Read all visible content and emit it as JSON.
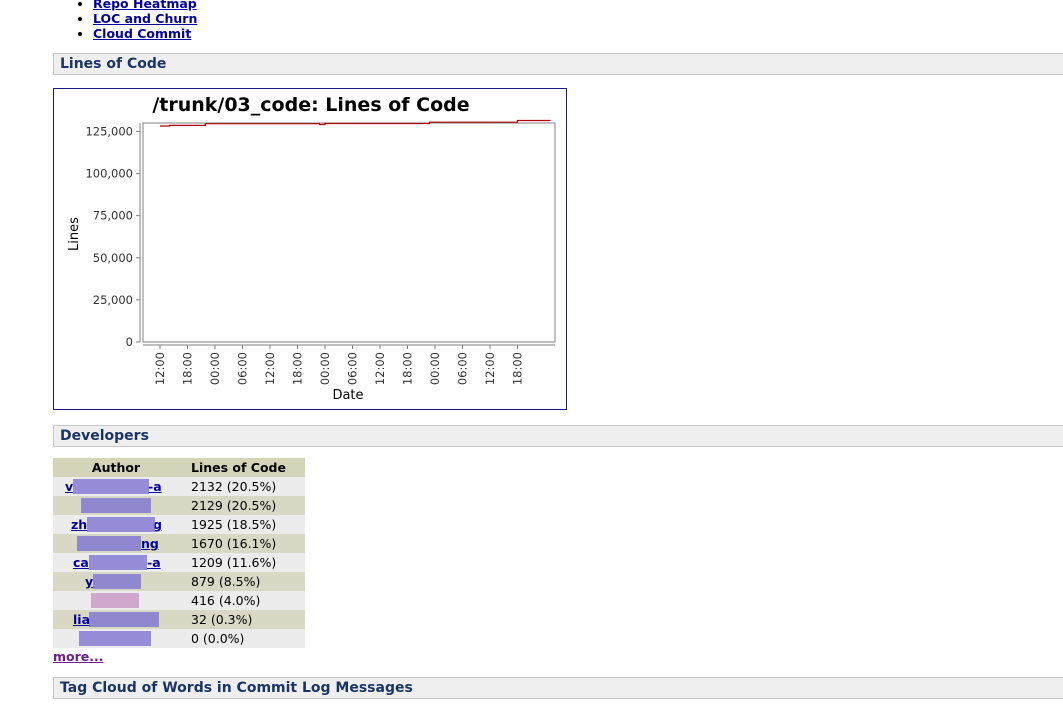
{
  "nav": {
    "items": [
      {
        "label": "Repo Heatmap"
      },
      {
        "label": "LOC and Churn"
      },
      {
        "label": "Cloud Commit"
      }
    ]
  },
  "sections": {
    "loc": "Lines of Code",
    "developers": "Developers",
    "tagcloud": "Tag Cloud of Words in Commit Log Messages"
  },
  "chart_data": {
    "type": "line",
    "title": "/trunk/03_code: Lines of Code",
    "xlabel": "Date",
    "ylabel": "Lines",
    "ylim": [
      0,
      130000
    ],
    "yticks": [
      0,
      25000,
      50000,
      75000,
      100000,
      125000
    ],
    "ytick_labels": [
      "0",
      "25,000",
      "50,000",
      "75,000",
      "100,000",
      "125,000"
    ],
    "xtick_labels": [
      "12:00",
      "18:00",
      "00:00",
      "06:00",
      "12:00",
      "18:00",
      "00:00",
      "06:00",
      "12:00",
      "18:00",
      "00:00",
      "06:00",
      "12:00",
      "18:00"
    ],
    "series": [
      {
        "color": "#b00000",
        "x": [
          0.0,
          0.35,
          0.35,
          1.65,
          1.65,
          5.8,
          5.8,
          6.0,
          6.0,
          9.8,
          9.8,
          13.0,
          13.0,
          14.2
        ],
        "y": [
          128200,
          128200,
          128600,
          128600,
          129600,
          129600,
          129100,
          129100,
          129700,
          129700,
          130500,
          130500,
          131500,
          131500
        ]
      }
    ],
    "grid": false,
    "legend": "none"
  },
  "developers": {
    "headers": {
      "author": "Author",
      "loc": "Lines of Code"
    },
    "rows": [
      {
        "author": "v",
        "author_tail": "-a",
        "loc": "2132 (20.5%)"
      },
      {
        "author": "",
        "author_tail": "",
        "loc": "2129 (20.5%)"
      },
      {
        "author": "zh",
        "author_tail": "g",
        "loc": "1925 (18.5%)"
      },
      {
        "author": "",
        "author_tail": "ng",
        "loc": "1670 (16.1%)"
      },
      {
        "author": "ca",
        "author_tail": "-a",
        "loc": "1209 (11.6%)"
      },
      {
        "author": "y",
        "author_tail": "",
        "loc": "879 (8.5%)"
      },
      {
        "author": "",
        "author_tail": "",
        "loc": "416 (4.0%)"
      },
      {
        "author": "lia",
        "author_tail": "",
        "loc": "32 (0.3%)"
      },
      {
        "author": "",
        "author_tail": "",
        "loc": "0 (0.0%)"
      }
    ],
    "more_label": "more..."
  }
}
